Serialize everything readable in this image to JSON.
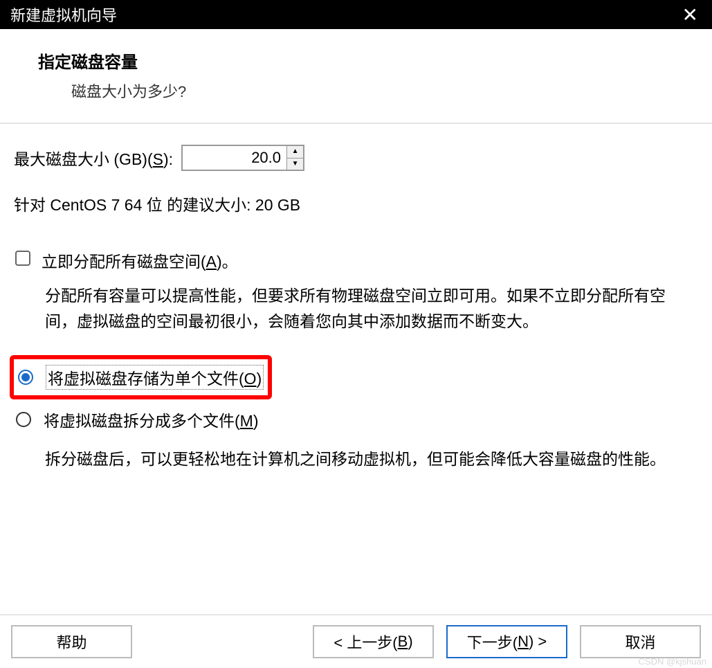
{
  "titlebar": {
    "title": "新建虚拟机向导"
  },
  "header": {
    "title": "指定磁盘容量",
    "subtitle": "磁盘大小为多少?"
  },
  "disk_size": {
    "label_prefix": "最大磁盘大小 (GB)(",
    "label_key": "S",
    "label_suffix": "):",
    "value": "20.0"
  },
  "recommendation": "针对 CentOS 7 64 位 的建议大小: 20 GB",
  "allocate": {
    "label_prefix": "立即分配所有磁盘空间(",
    "label_key": "A",
    "label_suffix": ")。",
    "description": "分配所有容量可以提高性能，但要求所有物理磁盘空间立即可用。如果不立即分配所有空间，虚拟磁盘的空间最初很小，会随着您向其中添加数据而不断变大。"
  },
  "radio_single": {
    "label_prefix": "将虚拟磁盘存储为单个文件(",
    "label_key": "O",
    "label_suffix": ")"
  },
  "radio_split": {
    "label_prefix": "将虚拟磁盘拆分成多个文件(",
    "label_key": "M",
    "label_suffix": ")",
    "description": "拆分磁盘后，可以更轻松地在计算机之间移动虚拟机，但可能会降低大容量磁盘的性能。"
  },
  "buttons": {
    "help": "帮助",
    "back_prefix": "< 上一步(",
    "back_key": "B",
    "back_suffix": ")",
    "next_prefix": "下一步(",
    "next_key": "N",
    "next_suffix": ") >",
    "cancel": "取消"
  },
  "watermark": "CSDN @kjshuan"
}
